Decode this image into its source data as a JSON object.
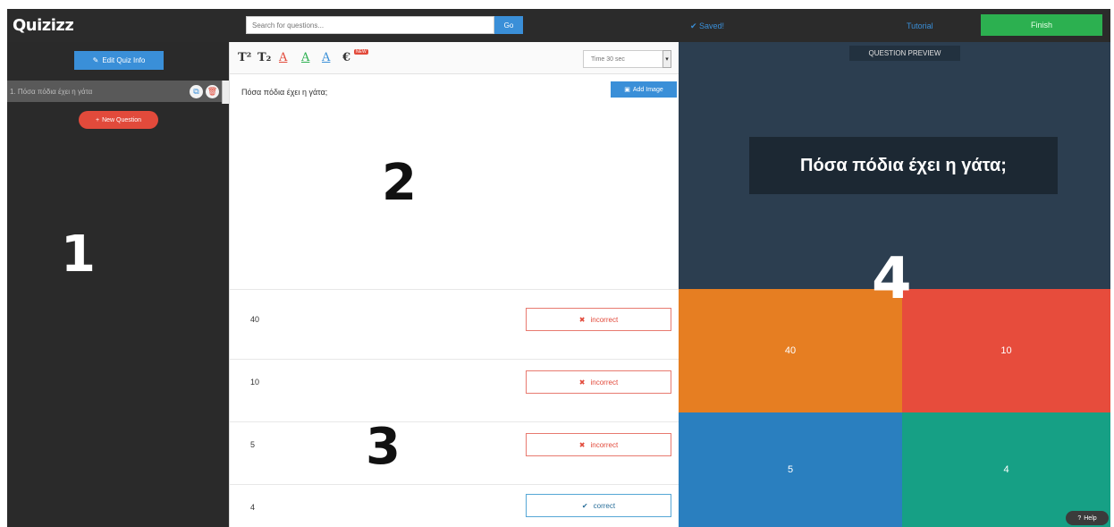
{
  "header": {
    "logo": "Quizizz",
    "search_placeholder": "Search for questions...",
    "search_button": "Go",
    "saved_label": "✔ Saved!",
    "tutorial_label": "Tutorial",
    "finish_label": "Finish"
  },
  "sidebar": {
    "edit_quiz_label": "Edit Quiz Info",
    "questions": [
      {
        "label": "1. Πόσα πόδια έχει η γάτα"
      }
    ],
    "new_question_label": "New Question",
    "overlay_number": "1"
  },
  "editor": {
    "toolbar": {
      "superscript": "T²",
      "subscript": "T₂",
      "color_a": "A",
      "new_badge": "NEW",
      "euro": "€",
      "time_select": "Time 30 sec"
    },
    "question_text": "Πόσα πόδια έχει η γάτα;",
    "add_image_label": "Add Image",
    "overlay_number_question": "2",
    "overlay_number_answers": "3",
    "answers": [
      {
        "text": "40",
        "status": "incorrect"
      },
      {
        "text": "10",
        "status": "incorrect"
      },
      {
        "text": "5",
        "status": "incorrect"
      },
      {
        "text": "4",
        "status": "correct"
      }
    ]
  },
  "preview": {
    "label": "QUESTION PREVIEW",
    "question": "Πόσα πόδια έχει η γάτα;",
    "tiles": [
      "40",
      "10",
      "5",
      "4"
    ],
    "overlay_number": "4",
    "help_label": "Help"
  },
  "colors": {
    "accent_blue": "#3a8fd8",
    "finish_green": "#2cb050",
    "danger_red": "#e24a3b",
    "tile_orange": "#e67e22",
    "tile_red": "#e74c3c",
    "tile_blue": "#2a7fbf",
    "tile_teal": "#16a085",
    "preview_bg": "#2c3e50"
  }
}
